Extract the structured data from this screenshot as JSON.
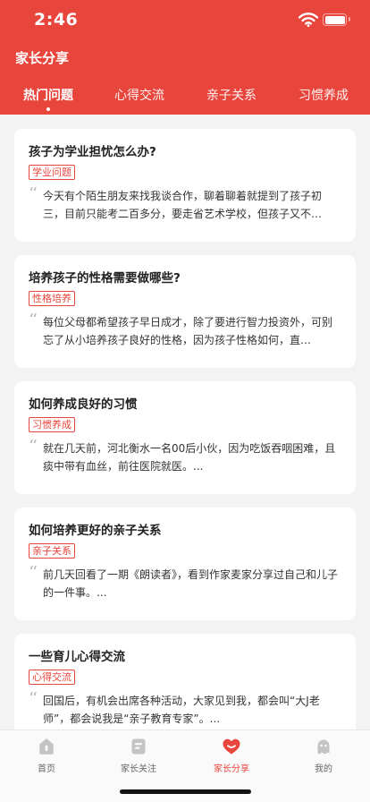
{
  "status_bar": {
    "time": "2:46"
  },
  "header": {
    "title": "家长分享"
  },
  "tabs": [
    {
      "label": "热门问题",
      "active": true
    },
    {
      "label": "心得交流",
      "active": false
    },
    {
      "label": "亲子关系",
      "active": false
    },
    {
      "label": "习惯养成",
      "active": false
    }
  ],
  "cards": [
    {
      "title": "孩子为学业担忧怎么办?",
      "tag": "学业问题",
      "excerpt": "今天有个陌生朋友来找我谈合作，聊着聊着就提到了孩子初三，目前只能考二百多分，要走省艺术学校，但孩子又不…"
    },
    {
      "title": "培养孩子的性格需要做哪些?",
      "tag": "性格培养",
      "excerpt": "每位父母都希望孩子早日成才，除了要进行智力投资外，可别忘了从小培养孩子良好的性格，因为孩子性格如何，直…"
    },
    {
      "title": "如何养成良好的习惯",
      "tag": "习惯养成",
      "excerpt": "就在几天前，河北衡水一名00后小伙，因为吃饭吞咽困难，且痰中带有血丝，前往医院就医。..."
    },
    {
      "title": "如何培养更好的亲子关系",
      "tag": "亲子关系",
      "excerpt": "前几天回看了一期《朗读者》，看到作家麦家分享过自己和儿子的一件事。..."
    },
    {
      "title": "一些育儿心得交流",
      "tag": "心得交流",
      "excerpt": "回国后，有机会出席各种活动，大家见到我，都会叫“大J老师”，都会说我是“亲子教育专家”。..."
    }
  ],
  "quote_glyph": "“",
  "tabbar": [
    {
      "label": "首页",
      "icon": "home-icon",
      "active": false
    },
    {
      "label": "家长关注",
      "icon": "document-icon",
      "active": false
    },
    {
      "label": "家长分享",
      "icon": "heart-icon",
      "active": true
    },
    {
      "label": "我的",
      "icon": "profile-icon",
      "active": false
    }
  ],
  "colors": {
    "brand": "#e8453c",
    "background": "#f3f3f3",
    "inactive_icon": "#c4c4c4"
  }
}
